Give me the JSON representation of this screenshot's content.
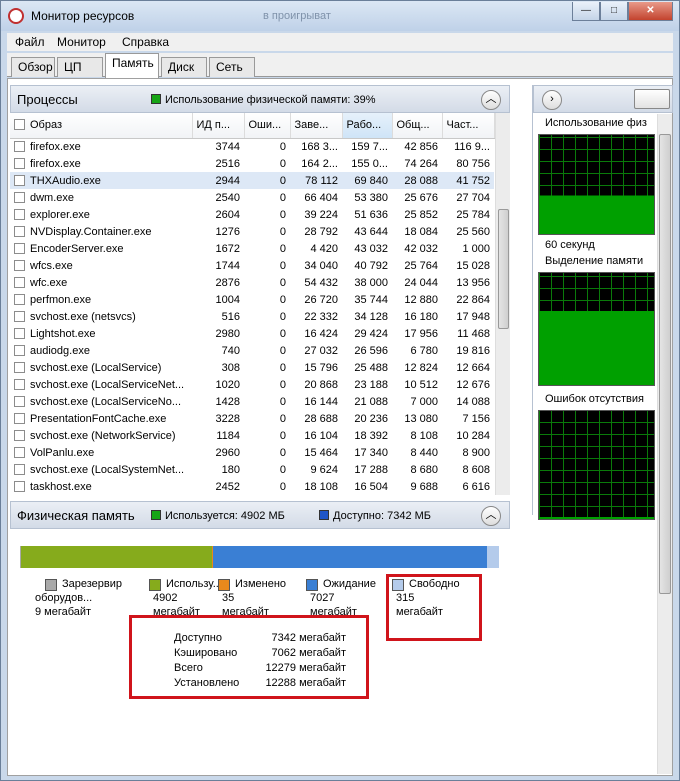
{
  "window": {
    "title": "Монитор ресурсов",
    "ghost_text": "в проигрыват",
    "minimize": "—",
    "maximize": "□",
    "close": "✕"
  },
  "menu": [
    "Файл",
    "Монитор",
    "Справка"
  ],
  "tabs": [
    "Обзор",
    "ЦП",
    "Память",
    "Диск",
    "Сеть"
  ],
  "processes": {
    "title": "Процессы",
    "legend_text": "Использование физической памяти: 39%",
    "legend_color": "#16a516",
    "columns": [
      "Образ",
      "ИД п...",
      "Оши...",
      "Заве...",
      "Рабо...",
      "Общ...",
      "Част..."
    ],
    "rows": [
      [
        "firefox.exe",
        "3744",
        "0",
        "168 3...",
        "159 7...",
        "42 856",
        "116 9..."
      ],
      [
        "firefox.exe",
        "2516",
        "0",
        "164 2...",
        "155 0...",
        "74 264",
        "80 756"
      ],
      [
        "THXAudio.exe",
        "2944",
        "0",
        "78 112",
        "69 840",
        "28 088",
        "41 752"
      ],
      [
        "dwm.exe",
        "2540",
        "0",
        "66 404",
        "53 380",
        "25 676",
        "27 704"
      ],
      [
        "explorer.exe",
        "2604",
        "0",
        "39 224",
        "51 636",
        "25 852",
        "25 784"
      ],
      [
        "NVDisplay.Container.exe",
        "1276",
        "0",
        "28 792",
        "43 644",
        "18 084",
        "25 560"
      ],
      [
        "EncoderServer.exe",
        "1672",
        "0",
        "4 420",
        "43 032",
        "42 032",
        "1 000"
      ],
      [
        "wfcs.exe",
        "1744",
        "0",
        "34 040",
        "40 792",
        "25 764",
        "15 028"
      ],
      [
        "wfc.exe",
        "2876",
        "0",
        "54 432",
        "38 000",
        "24 044",
        "13 956"
      ],
      [
        "perfmon.exe",
        "1004",
        "0",
        "26 720",
        "35 744",
        "12 880",
        "22 864"
      ],
      [
        "svchost.exe (netsvcs)",
        "516",
        "0",
        "22 332",
        "34 128",
        "16 180",
        "17 948"
      ],
      [
        "Lightshot.exe",
        "2980",
        "0",
        "16 424",
        "29 424",
        "17 956",
        "11 468"
      ],
      [
        "audiodg.exe",
        "740",
        "0",
        "27 032",
        "26 596",
        "6 780",
        "19 816"
      ],
      [
        "svchost.exe (LocalService)",
        "308",
        "0",
        "15 796",
        "25 488",
        "12 824",
        "12 664"
      ],
      [
        "svchost.exe (LocalServiceNet...",
        "1020",
        "0",
        "20 868",
        "23 188",
        "10 512",
        "12 676"
      ],
      [
        "svchost.exe (LocalServiceNo...",
        "1428",
        "0",
        "16 144",
        "21 088",
        "7 000",
        "14 088"
      ],
      [
        "PresentationFontCache.exe",
        "3228",
        "0",
        "28 688",
        "20 236",
        "13 080",
        "7 156"
      ],
      [
        "svchost.exe (NetworkService)",
        "1184",
        "0",
        "16 104",
        "18 392",
        "8 108",
        "10 284"
      ],
      [
        "VolPanlu.exe",
        "2960",
        "0",
        "15 464",
        "17 340",
        "8 440",
        "8 900"
      ],
      [
        "svchost.exe (LocalSystemNet...",
        "180",
        "0",
        "9 624",
        "17 288",
        "8 680",
        "8 608"
      ],
      [
        "taskhost.exe",
        "2452",
        "0",
        "18 108",
        "16 504",
        "9 688",
        "6 616"
      ]
    ]
  },
  "physical": {
    "title": "Физическая память",
    "used_text": "Используется: 4902 МБ",
    "used_color": "#16a516",
    "available_text": "Доступно: 7342 МБ",
    "available_color": "#1f55c8",
    "bar": [
      {
        "label": "Зарезервир",
        "line2": "оборудов...",
        "line3": "9 мегабайт",
        "value": 9,
        "color": "#a9a9a9"
      },
      {
        "label": "Использу...",
        "line2": "4902",
        "line3": "мегабайт",
        "value": 4902,
        "color": "#86ab1c"
      },
      {
        "label": "Изменено",
        "line2": "35",
        "line3": "мегабайт",
        "value": 35,
        "color": "#e8891c"
      },
      {
        "label": "Ожидание",
        "line2": "7027",
        "line3": "мегабайт",
        "value": 7027,
        "color": "#3a7fd4"
      },
      {
        "label": "Свободно",
        "line2": "315",
        "line3": "мегабайт",
        "value": 315,
        "color": "#b4cbeb"
      }
    ],
    "stats": [
      {
        "label": "Доступно",
        "value": "7342 мегабайт"
      },
      {
        "label": "Кэшировано",
        "value": "7062 мегабайт"
      },
      {
        "label": "Всего",
        "value": "12279 мегабайт"
      },
      {
        "label": "Установлено",
        "value": "12288 мегабайт"
      }
    ]
  },
  "right": {
    "graph1_title": "Использование физ",
    "graph1_footer": "60 секунд",
    "graph2_title": "Выделение памяти",
    "graph3_title": "Ошибок отсутствия",
    "graph1_fill": 0.39,
    "graph2_fill": 0.66,
    "graph_color": "#00a000"
  }
}
